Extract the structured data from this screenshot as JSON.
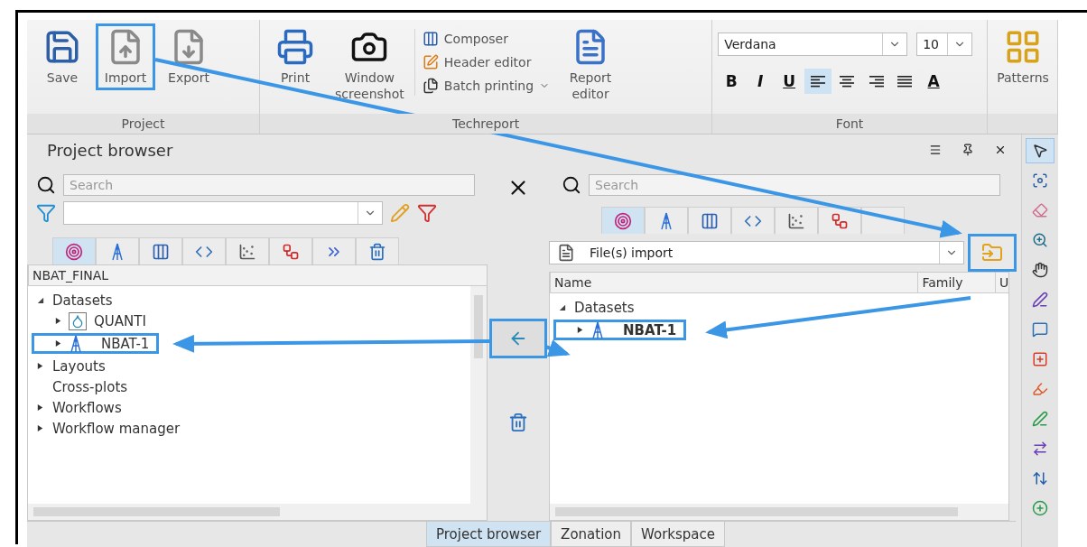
{
  "ribbon": {
    "groups": [
      {
        "label": "Project",
        "items": [
          {
            "kind": "large",
            "label": "Save",
            "highlighted": false
          },
          {
            "kind": "large",
            "label": "Import",
            "highlighted": true
          },
          {
            "kind": "large",
            "label": "Export",
            "highlighted": false
          }
        ]
      },
      {
        "label": "Techreport",
        "items": [
          {
            "kind": "large",
            "label": "Print",
            "highlighted": false
          },
          {
            "kind": "large",
            "label": "Window screenshot",
            "highlighted": false
          },
          {
            "kind": "stack",
            "entries": [
              {
                "label": "Composer",
                "dropdown": false
              },
              {
                "label": "Header editor",
                "dropdown": false
              },
              {
                "label": "Batch printing",
                "dropdown": true
              }
            ]
          },
          {
            "kind": "large",
            "label": "Report editor",
            "highlighted": false
          }
        ]
      },
      {
        "label": "Font",
        "items": [
          {
            "kind": "font",
            "font": "Verdana",
            "size": "10",
            "styles": [
              "B",
              "I",
              "U"
            ],
            "alignments": [
              {
                "selected": true
              },
              {
                "selected": false
              },
              {
                "selected": false
              },
              {
                "selected": false
              }
            ],
            "color_label": "A"
          }
        ]
      },
      {
        "items": [
          {
            "kind": "large",
            "label": "Patterns",
            "highlighted": false
          }
        ]
      }
    ]
  },
  "panel": {
    "title": "Project browser",
    "left": {
      "search": {
        "placeholder": "Search"
      },
      "category_tabs": [
        {
          "selected": true
        },
        {
          "selected": false
        },
        {
          "selected": false
        },
        {
          "selected": false
        },
        {
          "selected": false
        },
        {
          "selected": false
        },
        {
          "selected": false
        },
        {
          "selected": false
        }
      ],
      "tree_header": "NBAT_FINAL",
      "tree": [
        {
          "label": "Datasets",
          "expandable": true,
          "expanded": true,
          "highlighted": false,
          "bold": false,
          "children": [
            {
              "kind": "dataset",
              "label": "QUANTI",
              "expandable": true,
              "expanded": false,
              "highlighted": false,
              "bold": false
            },
            {
              "kind": "well",
              "label": "NBAT-1",
              "expandable": true,
              "expanded": false,
              "highlighted": true,
              "bold": false
            }
          ]
        },
        {
          "label": "Layouts",
          "expandable": true,
          "expanded": false,
          "highlighted": false,
          "bold": false
        },
        {
          "label": "Cross-plots",
          "expandable": false,
          "highlighted": false,
          "bold": false
        },
        {
          "label": "Workflows",
          "expandable": true,
          "expanded": false,
          "highlighted": false,
          "bold": false
        },
        {
          "label": "Workflow manager",
          "expandable": true,
          "expanded": false,
          "highlighted": false,
          "bold": false
        }
      ]
    },
    "transfer": {
      "highlighted": true
    },
    "right": {
      "search": {
        "placeholder": "Search"
      },
      "category_tabs": [
        {
          "selected": true
        },
        {
          "selected": false
        },
        {
          "selected": false
        },
        {
          "selected": false
        },
        {
          "selected": false
        },
        {
          "selected": false
        },
        {
          "selected": false
        }
      ],
      "import_source": "File(s) import",
      "open_highlighted": true,
      "columns": [
        "Name",
        "Family",
        "U"
      ],
      "tree": [
        {
          "label": "Datasets",
          "expandable": true,
          "expanded": true,
          "highlighted": false,
          "bold": false,
          "children": [
            {
              "kind": "well",
              "label": "NBAT-1",
              "expandable": true,
              "expanded": false,
              "highlighted": true,
              "bold": true
            }
          ]
        }
      ]
    },
    "bottom_tabs": [
      {
        "label": "Project browser",
        "selected": true
      },
      {
        "label": "Zonation",
        "selected": false
      },
      {
        "label": "Workspace",
        "selected": false
      }
    ]
  },
  "tools": [
    {
      "selected": true
    },
    {
      "selected": false
    },
    {
      "selected": false
    },
    {
      "selected": false
    },
    {
      "selected": false
    },
    {
      "selected": false
    },
    {
      "selected": false
    },
    {
      "selected": false
    },
    {
      "selected": false
    },
    {
      "selected": false
    },
    {
      "selected": false
    },
    {
      "selected": false
    },
    {
      "selected": false
    }
  ]
}
